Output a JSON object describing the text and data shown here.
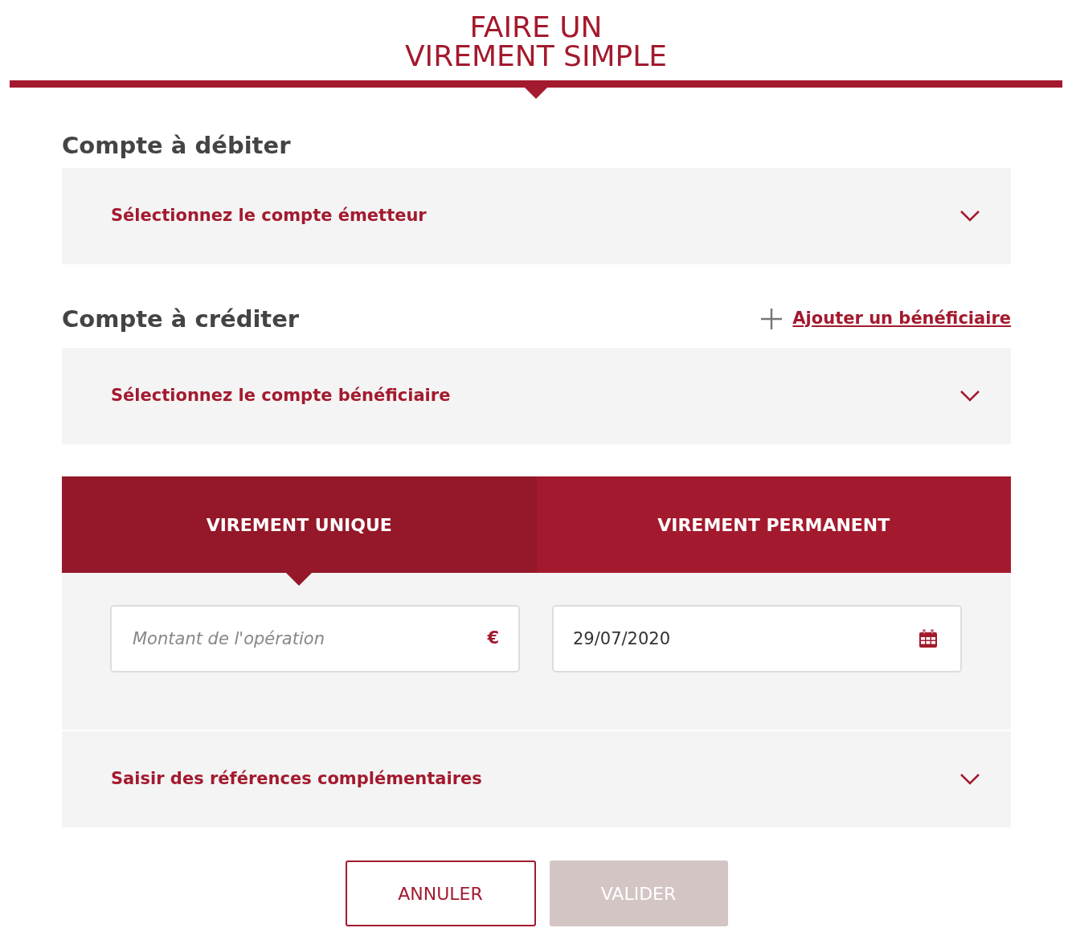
{
  "title_lines": [
    "FAIRE UN",
    "VIREMENT SIMPLE"
  ],
  "debit": {
    "heading": "Compte à débiter",
    "select": {
      "label": "Sélectionnez le compte émetteur"
    }
  },
  "credit": {
    "heading": "Compte à créditer",
    "add_link": "Ajouter un bénéficiaire",
    "select": {
      "label": "Sélectionnez le compte bénéficiaire"
    }
  },
  "tabs": [
    {
      "label": "VIREMENT UNIQUE",
      "selected": true
    },
    {
      "label": "VIREMENT PERMANENT",
      "selected": false
    }
  ],
  "amount": {
    "placeholder": "Montant de l'opération",
    "suffix": "€"
  },
  "date": {
    "value": "29/07/2020"
  },
  "references": {
    "label": "Saisir des références complémentaires"
  },
  "buttons": [
    {
      "label": "ANNULER",
      "kind": "secondary",
      "disabled": false
    },
    {
      "label": "VALIDER",
      "kind": "primary",
      "disabled": true
    }
  ]
}
